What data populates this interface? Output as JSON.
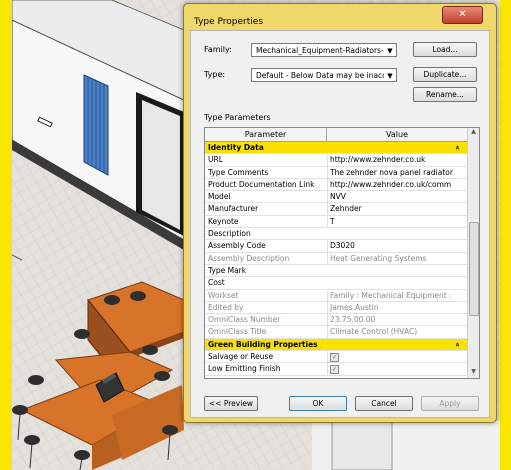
{
  "dialog": {
    "title": "Type Properties",
    "close_label": "✕",
    "family_label": "Family:",
    "family_value": "Mechanical_Equipment-Radiators-Zehnde",
    "type_label": "Type:",
    "type_value": "Default - Below Data may be inaccurate",
    "load_label": "Load...",
    "duplicate_label": "Duplicate...",
    "rename_label": "Rename...",
    "type_parameters_label": "Type Parameters",
    "col_parameter": "Parameter",
    "col_value": "Value",
    "rows": [
      {
        "kind": "group",
        "p": "Identity Data",
        "v": ""
      },
      {
        "kind": "row",
        "p": "URL",
        "v": "http://www.zehnder.co.uk"
      },
      {
        "kind": "row",
        "p": "Type Comments",
        "v": "The zehnder nova panel radiator"
      },
      {
        "kind": "row",
        "p": "Product Documentation Link",
        "v": "http://www.zehnder.co.uk/comm"
      },
      {
        "kind": "row",
        "p": "Model",
        "v": "NVV"
      },
      {
        "kind": "row",
        "p": "Manufacturer",
        "v": "Zehnder"
      },
      {
        "kind": "row",
        "p": "Keynote",
        "v": "T"
      },
      {
        "kind": "row",
        "p": "Description",
        "v": ""
      },
      {
        "kind": "row",
        "p": "Assembly Code",
        "v": "D3020"
      },
      {
        "kind": "grey",
        "p": "Assembly Description",
        "v": "Heat Generating Systems"
      },
      {
        "kind": "row",
        "p": "Type Mark",
        "v": ""
      },
      {
        "kind": "row",
        "p": "Cost",
        "v": ""
      },
      {
        "kind": "grey",
        "p": "Workset",
        "v": "Family : Mechanical Equipment :"
      },
      {
        "kind": "grey",
        "p": "Edited by",
        "v": "James.Austin"
      },
      {
        "kind": "grey",
        "p": "OmniClass Number",
        "v": "23.75.00.00"
      },
      {
        "kind": "grey",
        "p": "OmniClass Title",
        "v": "Climate Control (HVAC)"
      },
      {
        "kind": "group",
        "p": "Green Building Properties",
        "v": ""
      },
      {
        "kind": "check",
        "p": "Salvage or Reuse",
        "v": "✓"
      },
      {
        "kind": "check",
        "p": "Low Emitting Finish",
        "v": "✓"
      }
    ],
    "preview_label": "<< Preview",
    "ok_label": "OK",
    "cancel_label": "Cancel",
    "apply_label": "Apply"
  }
}
